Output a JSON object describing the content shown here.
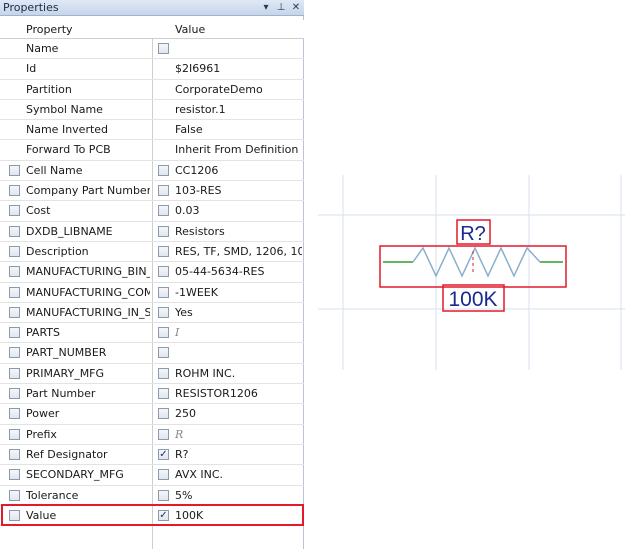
{
  "panel": {
    "title": "Properties",
    "controls": {
      "dropdown": "▾",
      "pin": "⊥",
      "close": "✕"
    },
    "header": {
      "property": "Property",
      "value": "Value"
    },
    "rows": [
      {
        "property": "Name",
        "value": "",
        "left_checkbox": false,
        "value_checkbox": true,
        "value_checked": false
      },
      {
        "property": "Id",
        "value": "$2I6961",
        "left_checkbox": false,
        "value_checkbox": false
      },
      {
        "property": "Partition",
        "value": "CorporateDemo",
        "left_checkbox": false,
        "value_checkbox": false
      },
      {
        "property": "Symbol Name",
        "value": "resistor.1",
        "left_checkbox": false,
        "value_checkbox": false
      },
      {
        "property": "Name Inverted",
        "value": "False",
        "left_checkbox": false,
        "value_checkbox": false
      },
      {
        "property": "Forward To PCB",
        "value": "Inherit From Definition",
        "left_checkbox": false,
        "value_checkbox": false
      },
      {
        "property": "Cell Name",
        "value": "CC1206",
        "left_checkbox": true,
        "value_checkbox": true,
        "value_checked": false
      },
      {
        "property": "Company Part Number",
        "value": "103-RES",
        "left_checkbox": true,
        "value_checkbox": true,
        "value_checked": false
      },
      {
        "property": "Cost",
        "value": "0.03",
        "left_checkbox": true,
        "value_checkbox": true,
        "value_checked": false
      },
      {
        "property": "DXDB_LIBNAME",
        "value": "Resistors",
        "left_checkbox": true,
        "value_checkbox": true,
        "value_checked": false
      },
      {
        "property": "Description",
        "value": "RES, TF, SMD, 1206, 10",
        "left_checkbox": true,
        "value_checkbox": true,
        "value_checked": false
      },
      {
        "property": "MANUFACTURING_BIN_I",
        "value": "05-44-5634-RES",
        "left_checkbox": true,
        "value_checkbox": true,
        "value_checked": false
      },
      {
        "property": "MANUFACTURING_COMP",
        "value": "-1WEEK",
        "left_checkbox": true,
        "value_checkbox": true,
        "value_checked": false
      },
      {
        "property": "MANUFACTURING_IN_ST",
        "value": "Yes",
        "left_checkbox": true,
        "value_checkbox": true,
        "value_checked": false
      },
      {
        "property": "PARTS",
        "value": "I",
        "placeholder": true,
        "left_checkbox": true,
        "value_checkbox": true,
        "value_checked": false
      },
      {
        "property": "PART_NUMBER",
        "value": "",
        "left_checkbox": true,
        "value_checkbox": true,
        "value_checked": false
      },
      {
        "property": "PRIMARY_MFG",
        "value": "ROHM INC.",
        "left_checkbox": true,
        "value_checkbox": true,
        "value_checked": false
      },
      {
        "property": "Part Number",
        "value": "RESISTOR1206",
        "left_checkbox": true,
        "value_checkbox": true,
        "value_checked": false
      },
      {
        "property": "Power",
        "value": "250",
        "left_checkbox": true,
        "value_checkbox": true,
        "value_checked": false
      },
      {
        "property": "Prefix",
        "value": "R",
        "placeholder": true,
        "left_checkbox": true,
        "value_checkbox": true,
        "value_checked": false
      },
      {
        "property": "Ref Designator",
        "value": "R?",
        "left_checkbox": true,
        "value_checkbox": true,
        "value_checked": true
      },
      {
        "property": "SECONDARY_MFG",
        "value": "AVX INC.",
        "left_checkbox": true,
        "value_checkbox": true,
        "value_checked": false
      },
      {
        "property": "Tolerance",
        "value": "5%",
        "left_checkbox": true,
        "value_checkbox": true,
        "value_checked": false
      },
      {
        "property": "Value",
        "value": "100K",
        "left_checkbox": true,
        "value_checkbox": true,
        "value_checked": true,
        "highlighted": true
      }
    ]
  },
  "schematic": {
    "ref_label": "R?",
    "value_label": "100K",
    "colors": {
      "wire": "#2f9e2f",
      "body": "#8ab0cc",
      "selection": "#e21a2a",
      "label": "#1a2a8c",
      "grid": "#d7e1ec"
    }
  }
}
